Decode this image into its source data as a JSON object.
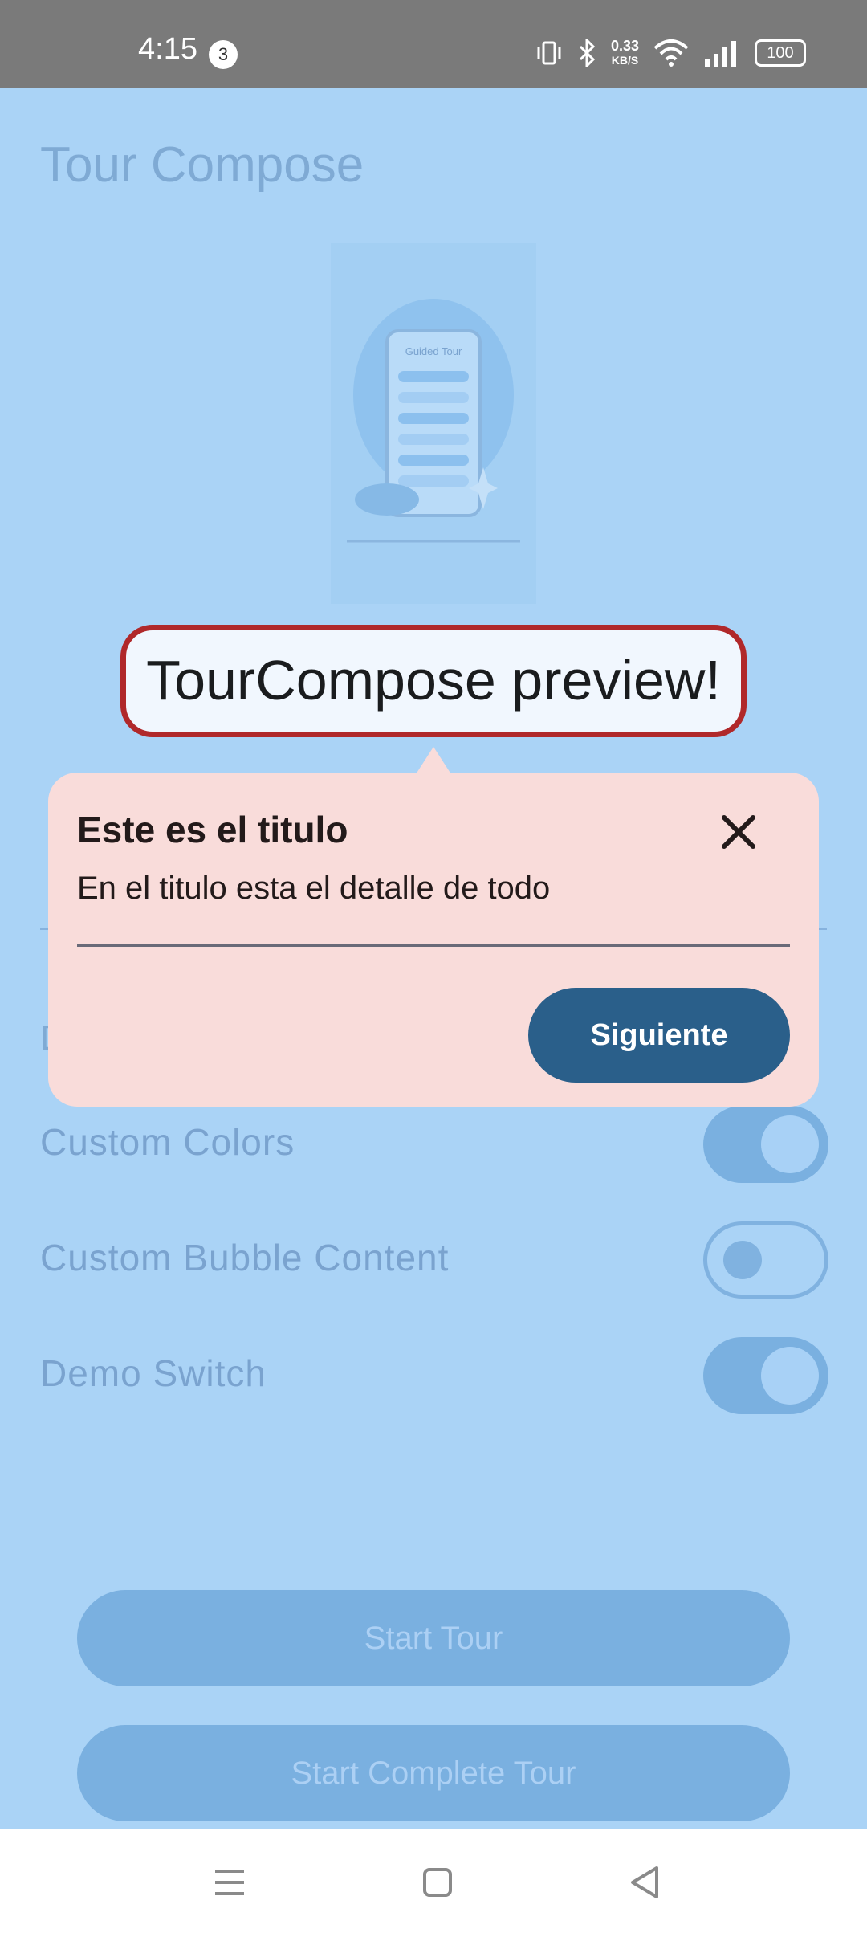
{
  "status_bar": {
    "time": "4:15",
    "notification_count": "3",
    "net_speed_value": "0.33",
    "net_speed_unit": "KB/S",
    "battery": "100"
  },
  "app": {
    "title": "Tour Compose",
    "hero_image_alt": "Guided Tour",
    "hidden_section_letter": "D",
    "settings": [
      {
        "label": "Custom Colors",
        "enabled": true
      },
      {
        "label": "Custom Bubble Content",
        "enabled": false
      },
      {
        "label": "Demo Switch",
        "enabled": true
      }
    ],
    "start_tour_label": "Start Tour",
    "start_complete_tour_label": "Start Complete Tour"
  },
  "tour": {
    "highlight_text": "TourCompose preview!",
    "title": "Este es el titulo",
    "description": "En el titulo esta el detalle de todo",
    "next_label": "Siguiente"
  },
  "colors": {
    "highlight_border": "#b0282a",
    "bubble_bg": "#f9dcda",
    "next_button": "#2a5f8a",
    "app_bg_dimmed": "#aad3f6"
  },
  "icons": [
    "moon-icon",
    "close-icon",
    "menu-icon",
    "home-icon",
    "back-icon",
    "vibrate-icon",
    "bluetooth-icon",
    "wifi-icon",
    "signal-icon"
  ]
}
